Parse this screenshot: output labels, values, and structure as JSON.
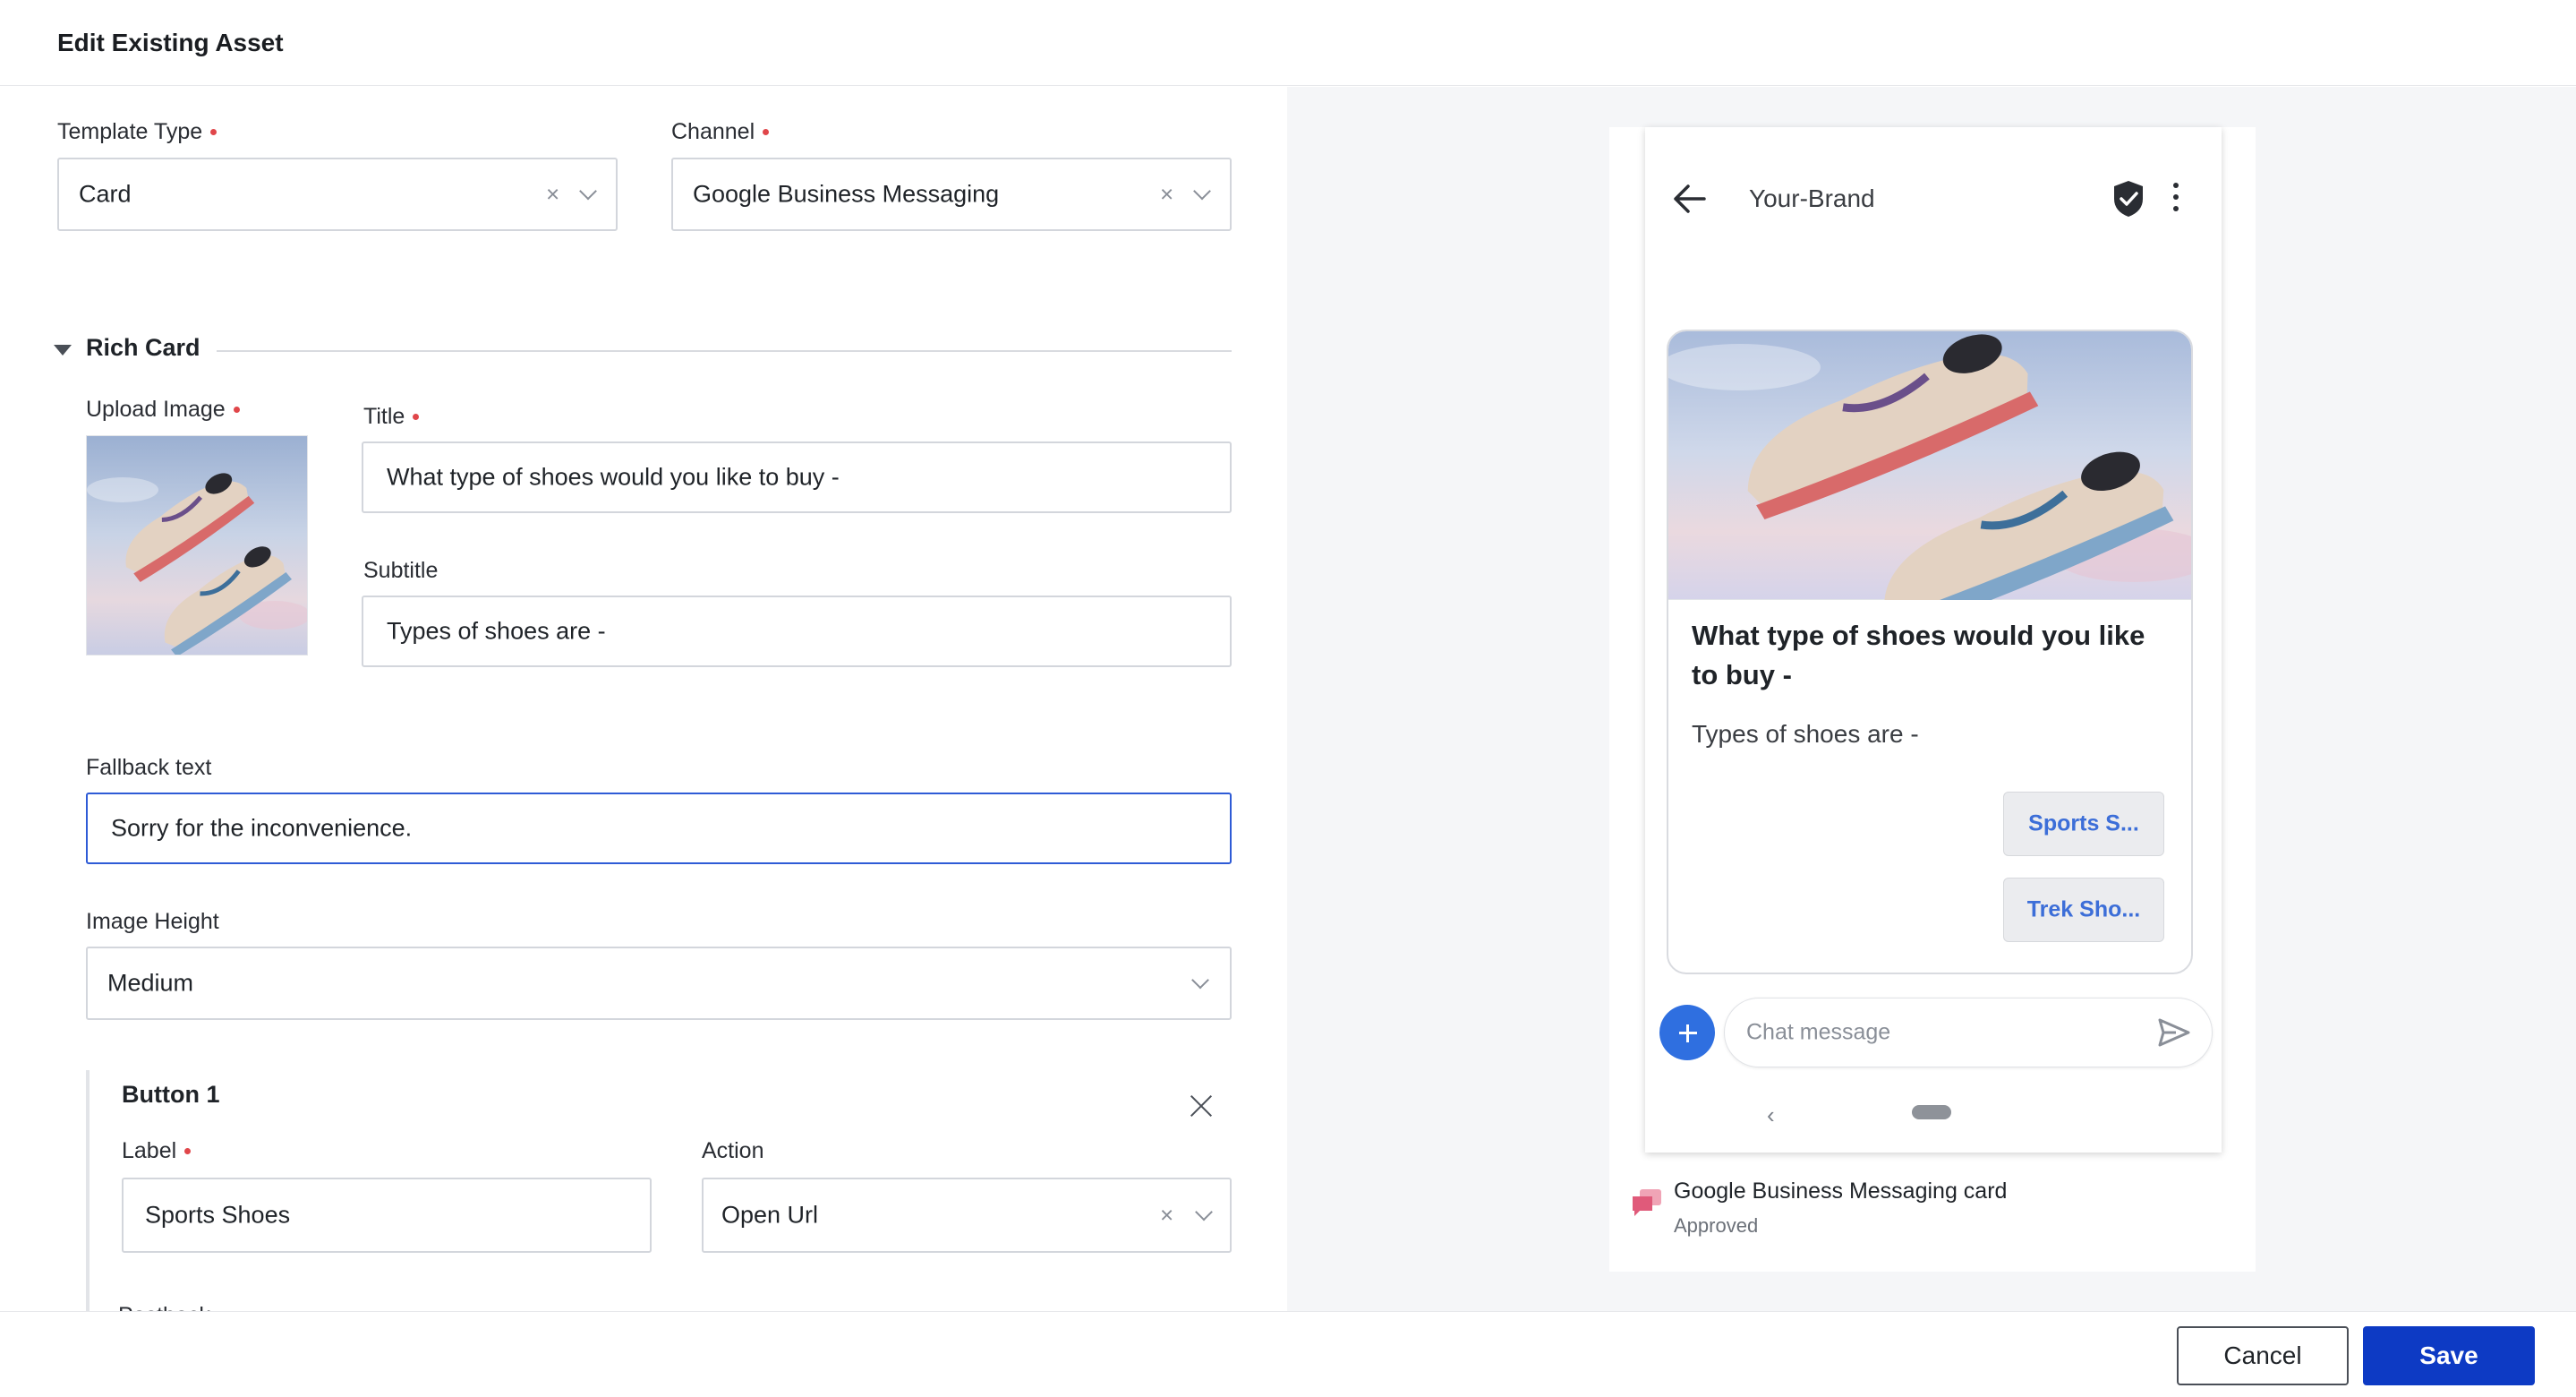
{
  "header": {
    "title": "Edit Existing Asset"
  },
  "form": {
    "template_type": {
      "label": "Template Type",
      "value": "Card",
      "clear": "×"
    },
    "channel": {
      "label": "Channel",
      "value": "Google Business Messaging",
      "clear": "×"
    },
    "section": {
      "title": "Rich Card"
    },
    "upload_image": {
      "label": "Upload Image"
    },
    "title": {
      "label": "Title",
      "value": "What type of shoes would you like to buy -"
    },
    "subtitle": {
      "label": "Subtitle",
      "value": "Types of shoes are -"
    },
    "fallback": {
      "label": "Fallback text",
      "value": "Sorry for the inconvenience."
    },
    "image_height": {
      "label": "Image Height",
      "value": "Medium"
    },
    "button1": {
      "title": "Button 1",
      "label_field": {
        "label": "Label",
        "value": "Sports Shoes"
      },
      "action_field": {
        "label": "Action",
        "value": "Open Url",
        "clear": "×"
      },
      "next_label_partial": "Postback"
    }
  },
  "preview": {
    "brand": "Your-Brand",
    "card_title": "What type of shoes would you like to buy -",
    "card_subtitle": "Types of shoes are -",
    "chips": [
      "Sports S...",
      "Trek Sho..."
    ],
    "chat_placeholder": "Chat message",
    "nav_back": "‹",
    "channel_name": "Google Business Messaging card",
    "status": "Approved"
  },
  "footer": {
    "cancel": "Cancel",
    "save": "Save"
  },
  "colors": {
    "primary": "#0d3ac4",
    "focus": "#2e5bd6",
    "required": "#e0464a",
    "chip_text": "#3c6ed8",
    "fab": "#2f6fe0",
    "gbm_icon": "#e05a7a"
  }
}
